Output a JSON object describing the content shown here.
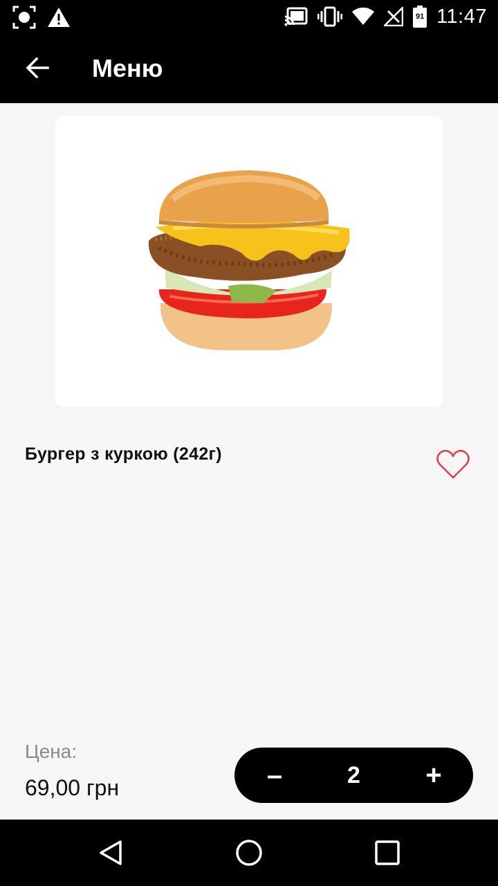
{
  "status_bar": {
    "time": "11:47",
    "battery_level": "91",
    "icons": [
      "screenshot-icon",
      "warning-icon",
      "cast-icon",
      "vibrate-icon",
      "wifi-icon",
      "signal-icon",
      "battery-icon"
    ]
  },
  "app_bar": {
    "title": "Меню",
    "back_icon": "arrow-left-icon"
  },
  "product": {
    "name": "Бургер з куркою (242г)",
    "image": "chicken-burger",
    "favorite_icon": "heart-outline-icon",
    "favorite": false
  },
  "purchase": {
    "price_label": "Цена:",
    "price": "69,00 грн",
    "quantity": "2",
    "minus_label": "–",
    "plus_label": "+"
  },
  "nav_bar": {
    "icons": [
      "back-triangle-icon",
      "home-circle-icon",
      "recents-square-icon"
    ]
  },
  "colors": {
    "bars": "#000000",
    "background": "#f6f6f6",
    "heart": "#d6444f",
    "price_label": "#8a8a8a"
  }
}
